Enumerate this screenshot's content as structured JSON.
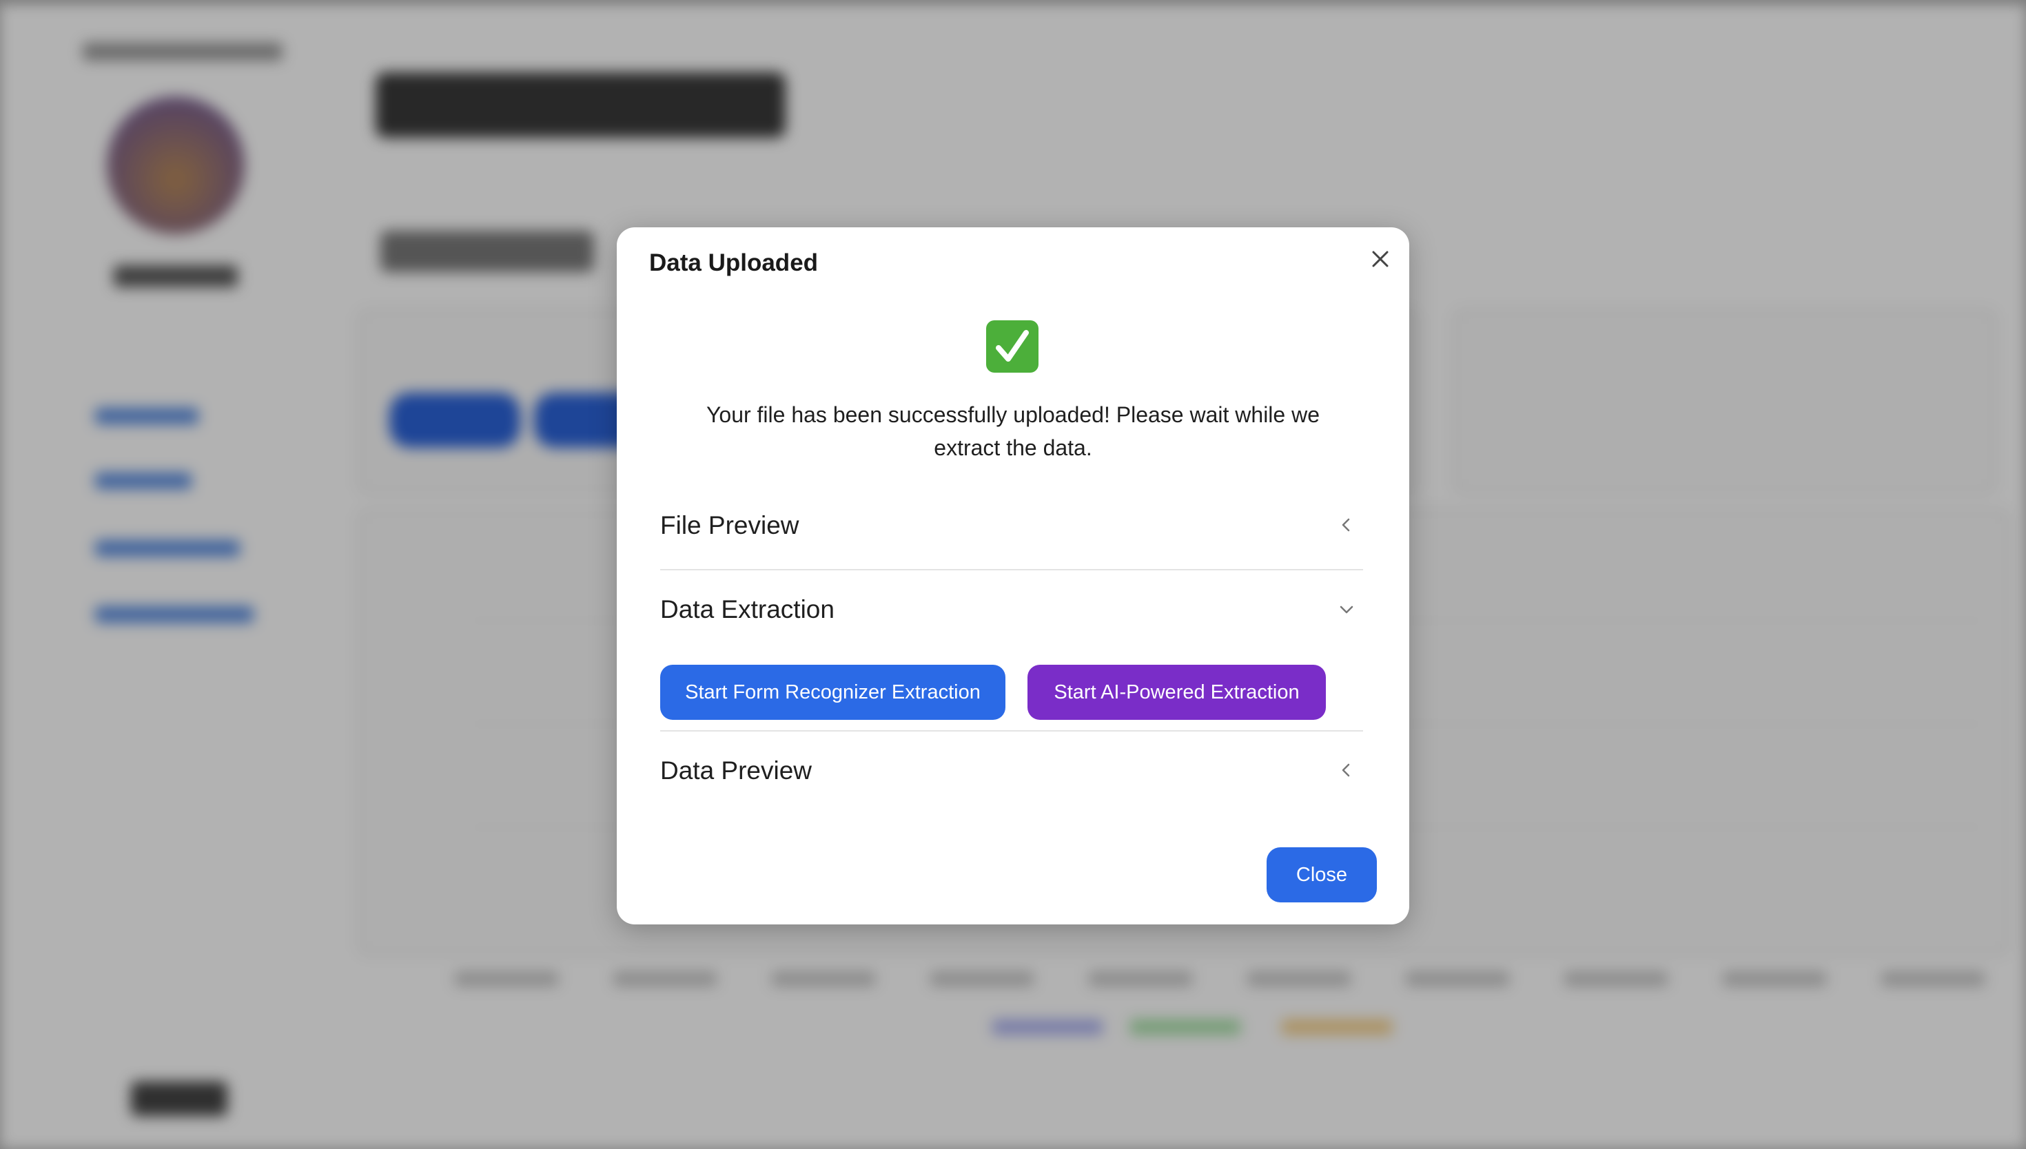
{
  "modal": {
    "title": "Data Uploaded",
    "message": "Your file has been successfully uploaded! Please wait while we extract the data.",
    "close_label": "Close"
  },
  "sections": {
    "file_preview": {
      "label": "File Preview",
      "state": "collapsed"
    },
    "data_extraction": {
      "label": "Data Extraction",
      "state": "expanded"
    },
    "data_preview": {
      "label": "Data Preview",
      "state": "collapsed"
    }
  },
  "extraction": {
    "form_recognizer_label": "Start Form Recognizer Extraction",
    "ai_powered_label": "Start AI-Powered Extraction"
  },
  "icons": {
    "success": "check-mark-icon",
    "close": "close-icon",
    "collapsed": "chevron-left-icon",
    "expanded": "chevron-down-icon"
  },
  "colors": {
    "primary": "#2b6ae6",
    "ai_accent": "#7a2dc8",
    "success": "#4caf3a"
  }
}
